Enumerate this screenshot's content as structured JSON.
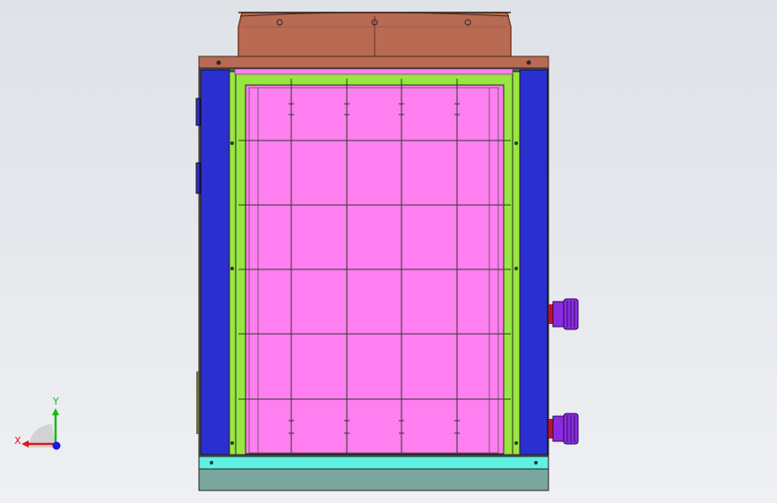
{
  "view": {
    "background_top": "#dfe3e8",
    "background_bottom": "#eef0f3"
  },
  "model": {
    "hood_color": "#b86a52",
    "hood_edge_color": "#7a3a2a",
    "side_panel_color": "#2b2fcf",
    "filter_frame_color": "#98e640",
    "filter_media_color": "#ff7ef0",
    "base_strip_color": "#5ef0e0",
    "base_color": "#7aa89e",
    "connector_color": "#8a2be2",
    "connector_ring_color": "#c0102a",
    "grid_columns": 5,
    "grid_rows": 6
  },
  "triad": {
    "x_label": "X",
    "y_label": "Y",
    "x_color": "#e01818",
    "y_color": "#18b818",
    "z_color": "#1818e0",
    "x_icon": "x-axis-arrow-icon",
    "y_icon": "y-axis-arrow-icon",
    "z_icon": "z-axis-dot-icon"
  }
}
